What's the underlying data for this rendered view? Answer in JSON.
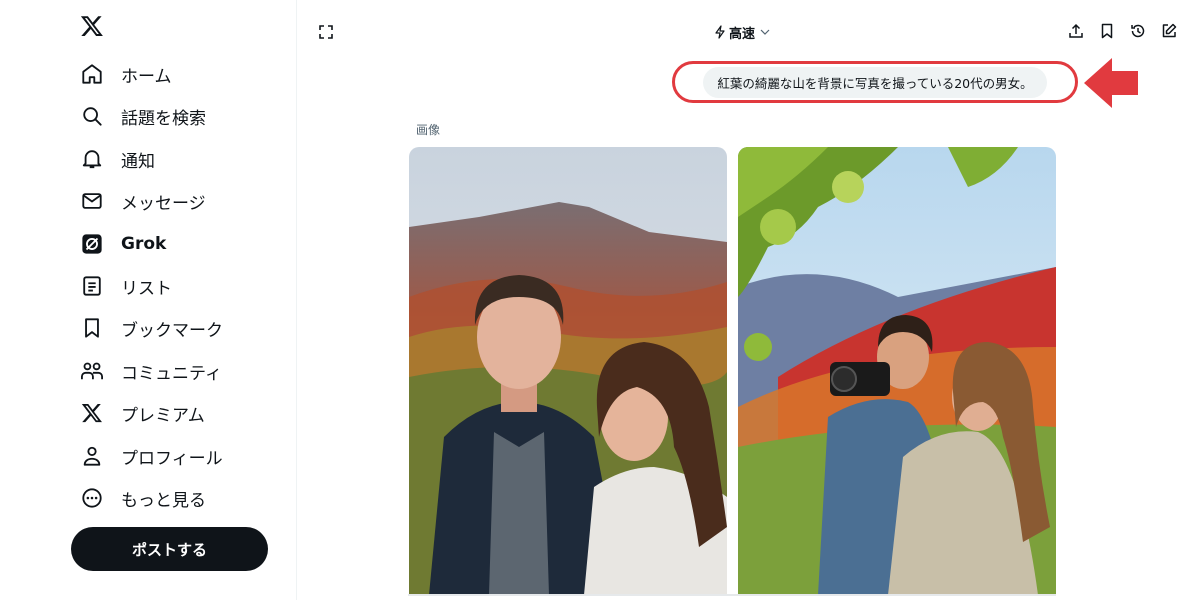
{
  "sidebar": {
    "items": [
      {
        "label": "ホーム",
        "icon": "home-icon"
      },
      {
        "label": "話題を検索",
        "icon": "search-icon"
      },
      {
        "label": "通知",
        "icon": "bell-icon"
      },
      {
        "label": "メッセージ",
        "icon": "mail-icon"
      },
      {
        "label": "Grok",
        "icon": "grok-icon"
      },
      {
        "label": "リスト",
        "icon": "list-icon"
      },
      {
        "label": "ブックマーク",
        "icon": "bookmark-icon"
      },
      {
        "label": "コミュニティ",
        "icon": "community-icon"
      },
      {
        "label": "プレミアム",
        "icon": "x-logo-icon"
      },
      {
        "label": "プロフィール",
        "icon": "person-icon"
      },
      {
        "label": "もっと見る",
        "icon": "more-icon"
      }
    ],
    "post_label": "ポストする"
  },
  "header": {
    "mode_label": "高速"
  },
  "chat": {
    "prompt": "紅葉の綺麗な山を背景に写真を撮っている20代の男女。",
    "images_label": "画像"
  },
  "colors": {
    "highlight_red": "#e13a3f",
    "post_button_bg": "#0f1419"
  }
}
